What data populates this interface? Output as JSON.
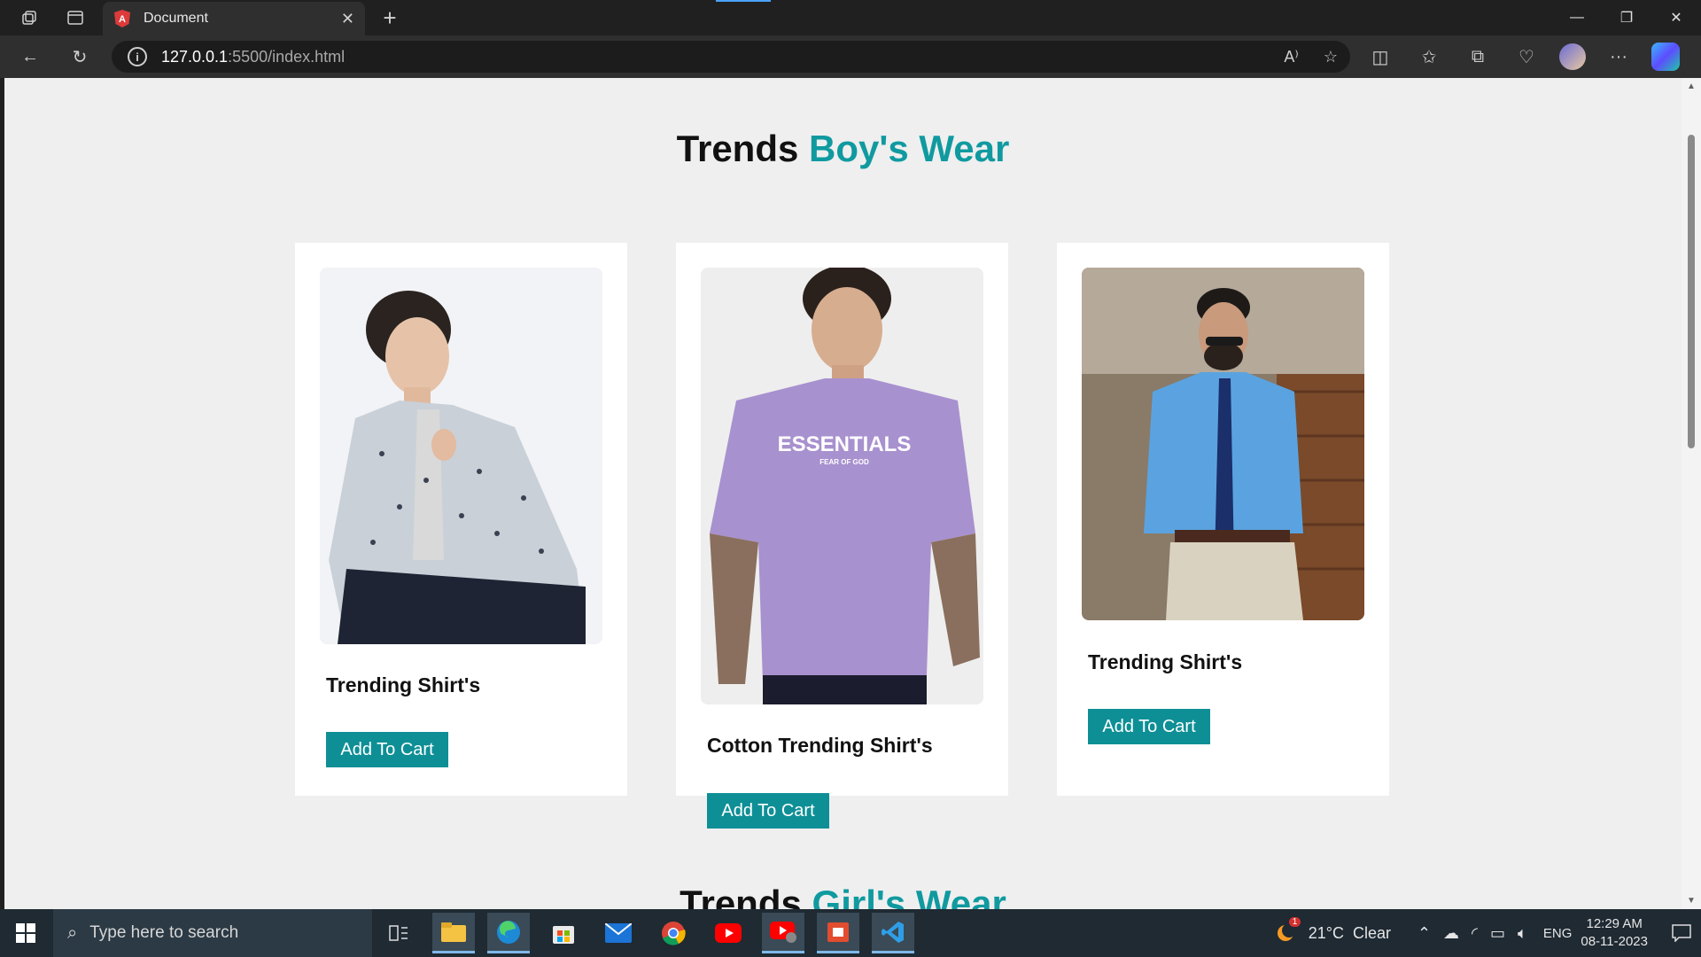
{
  "browser": {
    "tab_title": "Document",
    "url_host": "127.0.0.1",
    "url_path": ":5500/index.html"
  },
  "page": {
    "heading_prefix": "Trends",
    "heading_accent": "Boy's Wear",
    "next_heading_prefix": "Trends",
    "next_heading_accent": "Girl's Wear",
    "products": [
      {
        "title": "Trending Shirt's",
        "button": "Add To Cart",
        "image": "shirt-printed"
      },
      {
        "title": "Cotton Trending Shirt's",
        "button": "Add To Cart",
        "image": "tshirt-purple-essentials"
      },
      {
        "title": "Trending Shirt's",
        "button": "Add To Cart",
        "image": "shirt-blue-tie"
      }
    ],
    "tshirt_print": "ESSENTIALS",
    "tshirt_subprint": "FEAR OF GOD"
  },
  "taskbar": {
    "search_placeholder": "Type here to search",
    "weather": "21°C  Clear",
    "weather_badge": "1",
    "language": "ENG",
    "time": "12:29 AM",
    "date": "08-11-2023"
  },
  "colors": {
    "accent": "#109aa0",
    "button": "#0e8f96"
  }
}
